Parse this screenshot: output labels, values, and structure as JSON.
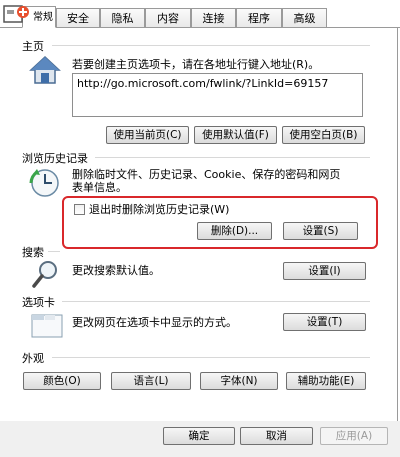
{
  "tabs": [
    "常规",
    "安全",
    "隐私",
    "内容",
    "连接",
    "程序",
    "高级"
  ],
  "home": {
    "title": "主页",
    "description": "若要创建主页选项卡，请在各地址行键入地址(R)。",
    "url": "http://go.microsoft.com/fwlink/?LinkId=69157",
    "buttons": [
      "使用当前页(C)",
      "使用默认值(F)",
      "使用空白页(B)"
    ]
  },
  "history": {
    "title": "浏览历史记录",
    "description_line1": "删除临时文件、历史记录、Cookie、保存的密码和网页",
    "description_line2": "表单信息。",
    "checkbox_label": "退出时删除浏览历史记录(W)",
    "delete_button": "删除(D)...",
    "settings_button": "设置(S)"
  },
  "search": {
    "title": "搜索",
    "description": "更改搜索默认值。",
    "settings_button": "设置(I)"
  },
  "tabsection": {
    "title": "选项卡",
    "description": "更改网页在选项卡中显示的方式。",
    "settings_button": "设置(T)"
  },
  "appearance": {
    "title": "外观",
    "buttons": [
      "颜色(O)",
      "语言(L)",
      "字体(N)",
      "辅助功能(E)"
    ]
  },
  "footer": {
    "ok": "确定",
    "cancel": "取消",
    "apply": "应用(A)"
  },
  "colors": {
    "highlight": "#d9282b",
    "logo_accent": "#e8502f"
  }
}
